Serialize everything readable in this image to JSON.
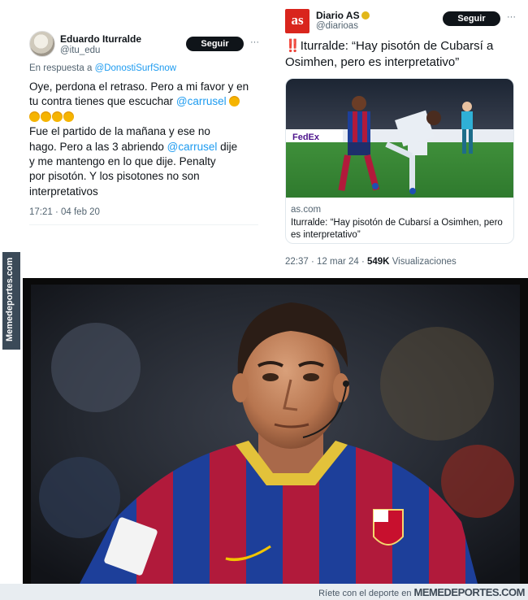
{
  "left_tweet": {
    "name": "Eduardo Iturralde",
    "handle": "@itu_edu",
    "follow_label": "Seguir",
    "more": "···",
    "reply_prefix": "En respuesta a ",
    "reply_mention": "@DonostiSurfSnow",
    "body": {
      "l1": "Oye, perdona el retraso. Pero a mi favor y en",
      "l2_pre": "tu contra tienes que escuchar ",
      "l2_mention": "@carrusel",
      "l4": "Fue el partido de la mañana y ese no",
      "l5": "hago. Pero a las 3 abriendo ",
      "l5_mention": "@carrusel",
      "l5_post": " dije",
      "l6": "y me mantengo en lo que dije. Penalty",
      "l7": "por pisotón. Y los pisotones no son",
      "l8": "interpretativos"
    },
    "timestamp": "17:21 · 04 feb 20",
    "emoji_name": "grinning-sweat-emoji"
  },
  "right_tweet": {
    "logo_text": "as",
    "name": "Diario AS",
    "handle": "@diarioas",
    "follow_label": "Seguir",
    "more": "···",
    "bang": "‼️",
    "title": "Iturralde: “Hay pisotón de Cubarsí a Osimhen, pero es interpretativo”",
    "card": {
      "domain": "as.com",
      "title": "Iturralde: “Hay pisotón de Cubarsí a Osimhen, pero es interpretativo”",
      "image_board_text": "FedEx"
    },
    "meta": {
      "time": "22:37 · 12 mar 24 · ",
      "views": "549K",
      "views_label": " Visualizaciones"
    }
  },
  "watermark": {
    "side": "Memedeportes.com",
    "footer_pre": "Ríete con el deporte en ",
    "footer_brand": "MEMEDEPORTES.COM"
  },
  "colors": {
    "link": "#1d9bf0",
    "as_red": "#d9251d",
    "barca_blue": "#1d3f9a",
    "barca_red": "#b11a3b"
  }
}
